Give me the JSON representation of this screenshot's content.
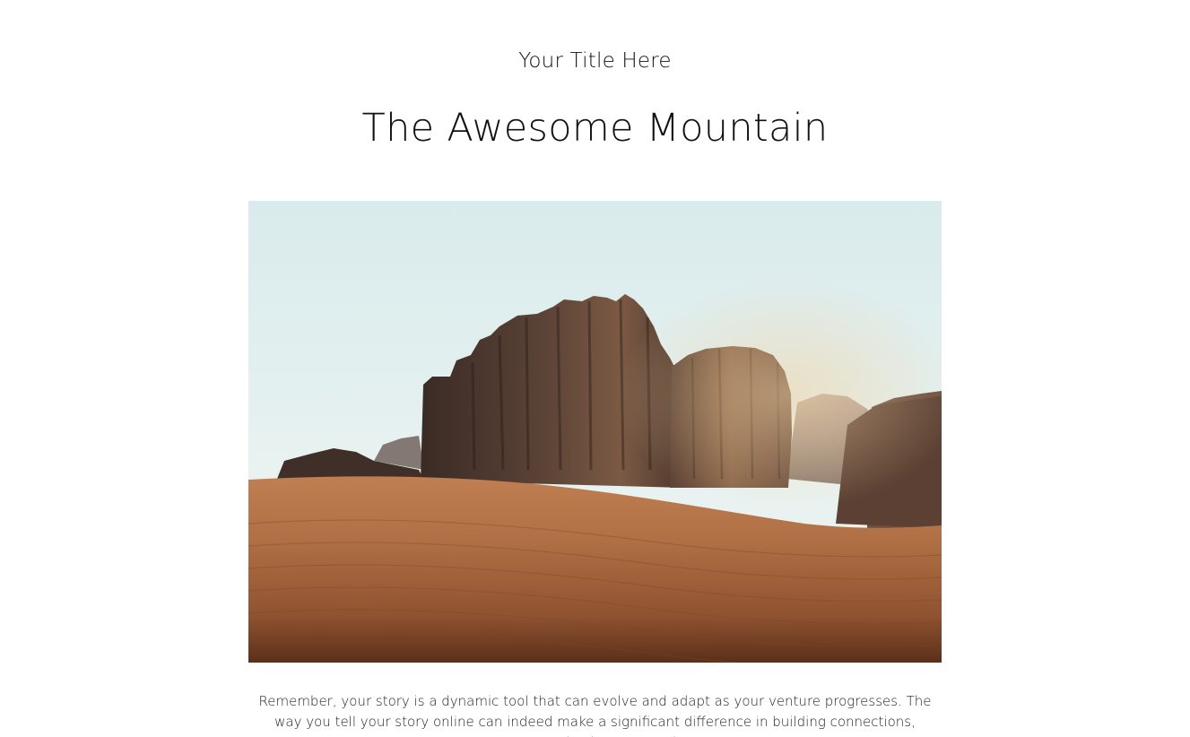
{
  "site": {
    "title": "Your Title Here"
  },
  "post": {
    "title": "The Awesome Mountain",
    "image_alt": "Desert sand dune with rocky mountains",
    "body": "Remember, your story is a dynamic tool that can evolve and adapt as your venture progresses. The way you tell your story online can indeed make a significant difference in building connections, generating interest, and"
  }
}
